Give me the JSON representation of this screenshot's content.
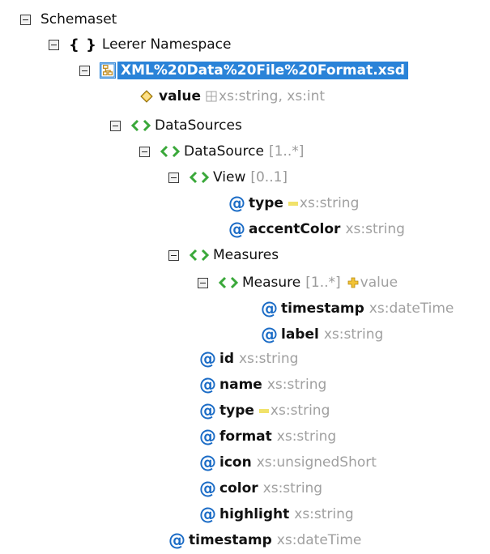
{
  "tree": {
    "root": "Schemaset",
    "namespace": "Leerer Namespace",
    "namespace_icon": "{ }",
    "file": "XML%20Data%20File%20Format.xsd",
    "value": {
      "name": "value",
      "type": "xs:string, xs:int"
    },
    "datasources": "DataSources",
    "datasource": {
      "name": "DataSource",
      "card": "[1..*]"
    },
    "view": {
      "name": "View",
      "card": "[0..1]"
    },
    "view_type": {
      "name": "type",
      "type": "xs:string"
    },
    "view_accent": {
      "name": "accentColor",
      "type": "xs:string"
    },
    "measures": "Measures",
    "measure": {
      "name": "Measure",
      "card": "[1..*]",
      "ext": "value"
    },
    "measure_timestamp": {
      "name": "timestamp",
      "type": "xs:dateTime"
    },
    "measure_label": {
      "name": "label",
      "type": "xs:string"
    },
    "ds_attrs": [
      {
        "name": "id",
        "type": "xs:string"
      },
      {
        "name": "name",
        "type": "xs:string"
      },
      {
        "name": "type",
        "type": "xs:string"
      },
      {
        "name": "format",
        "type": "xs:string"
      },
      {
        "name": "icon",
        "type": "xs:unsignedShort"
      },
      {
        "name": "color",
        "type": "xs:string"
      },
      {
        "name": "highlight",
        "type": "xs:string"
      }
    ],
    "ds_timestamp": {
      "name": "timestamp",
      "type": "xs:dateTime"
    }
  },
  "icons": {
    "attribute": "at-sign-icon",
    "element": "element-chevrons-icon",
    "expand": "collapse-minus-icon",
    "schema": "schema-file-icon",
    "value": "diamond-icon",
    "union": "union-icon",
    "extension": "plus-extension-icon"
  },
  "colors": {
    "accent": "#2a83d8",
    "attribute": "#1b6cc6",
    "element": "#3aa83a",
    "type_text": "#a0a0a0"
  }
}
